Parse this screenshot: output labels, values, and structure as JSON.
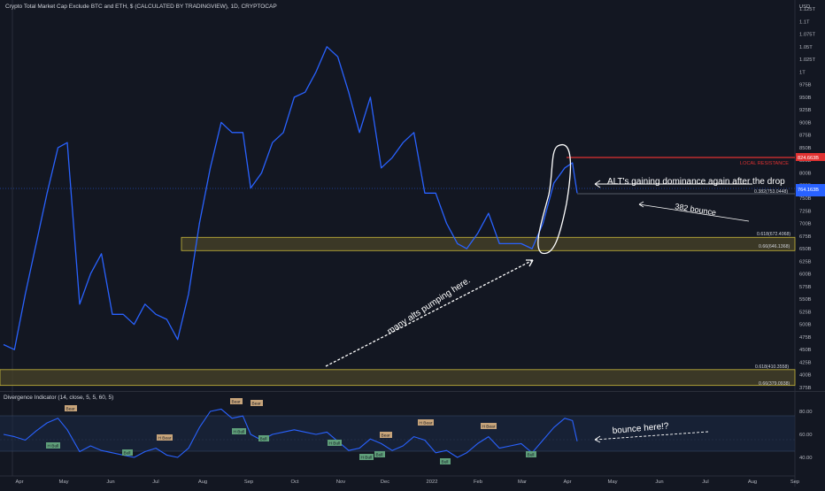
{
  "header": {
    "title": "Crypto Total Market Cap Exclude BTC and ETH, $ (CALCULATED BY TRADINGVIEW), 1D, CRYPTOCAP"
  },
  "colors": {
    "background": "#131722",
    "price_line": "#2962ff",
    "zone_fill": "#4a4428",
    "zone_border": "#c9b93a",
    "resistance": "#e03131",
    "annotation": "#ffffff",
    "bear_tag": "#c7a47a",
    "bull_tag": "#5f9f7a"
  },
  "price_axis": {
    "ticks": [
      "1.125T",
      "1.1T",
      "1.075T",
      "1.05T",
      "1.025T",
      "1T",
      "975B",
      "950B",
      "925B",
      "900B",
      "875B",
      "850B",
      "825B",
      "800B",
      "775B",
      "750B",
      "725B",
      "700B",
      "675B",
      "650B",
      "625B",
      "600B",
      "575B",
      "550B",
      "525B",
      "500B",
      "475B",
      "450B",
      "425B",
      "400B",
      "375B"
    ],
    "unit": "USD",
    "current_price_label": "764.163B",
    "resistance_label": "824.663B"
  },
  "time_axis": {
    "labels": [
      "Apr",
      "May",
      "Jun",
      "Jul",
      "Aug",
      "Sep",
      "Oct",
      "Nov",
      "Dec",
      "2022",
      "Feb",
      "Mar",
      "Apr",
      "May",
      "Jun",
      "Jul",
      "Aug",
      "Sep"
    ]
  },
  "fib_labels": {
    "f382": "0.382(753.0448)",
    "f618": "0.618(672.4068)",
    "f66": "0.66(646.1368)",
    "f618_low": "0.618(410.3558)",
    "f66_low": "0.66(379.0938)"
  },
  "annotations": {
    "local_resistance": "LOCAL RESISTANCE",
    "dominance": "ALT's gaining dominance again after the drop",
    "bounce_382": "382 bounce",
    "alts_pumping": "many alts pumping here.",
    "bounce_here": "bounce here!?"
  },
  "indicator": {
    "title": "Divergence Indicator (14, close, 5, 5, 60, 5)",
    "ticks": [
      "80.00",
      "60.00",
      "40.00"
    ],
    "tags": {
      "bear": "Bear",
      "h_bear": "H Bear",
      "bull": "Bull",
      "h_bull": "H Bull"
    }
  },
  "chart_data": {
    "type": "line",
    "title": "Crypto Total Market Cap Exclude BTC and ETH, $ (CALCULATED BY TRADINGVIEW), 1D, CRYPTOCAP",
    "ylim": [
      375,
      1125
    ],
    "y_unit": "B USD",
    "series": [
      {
        "values_note": "",
        "x": [
          "2021-04-01",
          "2021-04-08",
          "2021-04-15",
          "2021-04-22",
          "2021-04-29",
          "2021-05-06",
          "2021-05-12",
          "2021-05-20",
          "2021-05-27",
          "2021-06-03",
          "2021-06-10",
          "2021-06-17",
          "2021-06-24",
          "2021-07-01",
          "2021-07-08",
          "2021-07-15",
          "2021-07-22",
          "2021-07-29",
          "2021-08-05",
          "2021-08-12",
          "2021-08-19",
          "2021-08-26",
          "2021-09-02",
          "2021-09-07",
          "2021-09-14",
          "2021-09-21",
          "2021-09-28",
          "2021-10-05",
          "2021-10-12",
          "2021-10-19",
          "2021-10-26",
          "2021-11-02",
          "2021-11-09",
          "2021-11-16",
          "2021-11-23",
          "2021-11-30",
          "2021-12-07",
          "2021-12-14",
          "2021-12-21",
          "2021-12-28",
          "2022-01-04",
          "2022-01-11",
          "2022-01-18",
          "2022-01-24",
          "2022-01-31",
          "2022-02-07",
          "2022-02-14",
          "2022-02-21",
          "2022-02-28",
          "2022-03-07",
          "2022-03-14",
          "2022-03-21",
          "2022-03-28",
          "2022-04-02",
          "2022-04-05"
        ],
        "values": [
          460,
          450,
          560,
          660,
          760,
          850,
          860,
          540,
          600,
          640,
          520,
          520,
          500,
          540,
          520,
          510,
          470,
          560,
          700,
          810,
          900,
          880,
          880,
          770,
          800,
          860,
          880,
          950,
          960,
          1000,
          1050,
          1030,
          960,
          880,
          950,
          810,
          830,
          860,
          880,
          760,
          760,
          700,
          660,
          650,
          680,
          720,
          660,
          660,
          660,
          650,
          700,
          780,
          810,
          820,
          760
        ]
      }
    ],
    "levels": [
      {
        "name": "LOCAL RESISTANCE",
        "value": 824.663
      },
      {
        "name": "0.382",
        "value": 753.0448
      },
      {
        "name": "0.618",
        "value": 672.4068
      },
      {
        "name": "0.66",
        "value": 646.1368
      },
      {
        "name": "0.618",
        "value": 410.3558
      },
      {
        "name": "0.66",
        "value": 379.0938
      }
    ],
    "indicator_ylim": [
      30,
      90
    ],
    "indicator_series": [
      {
        "values": [
          60,
          58,
          55,
          63,
          70,
          74,
          64,
          45,
          50,
          46,
          44,
          42,
          40,
          45,
          48,
          42,
          40,
          48,
          66,
          80,
          82,
          74,
          76,
          60,
          55,
          60,
          62,
          64,
          62,
          60,
          62,
          54,
          46,
          48,
          56,
          52,
          46,
          50,
          58,
          55,
          44,
          46,
          40,
          44,
          52,
          58,
          48,
          50,
          52,
          44,
          55,
          66,
          74,
          72,
          54
        ]
      }
    ],
    "legend": "none",
    "grid": false
  }
}
